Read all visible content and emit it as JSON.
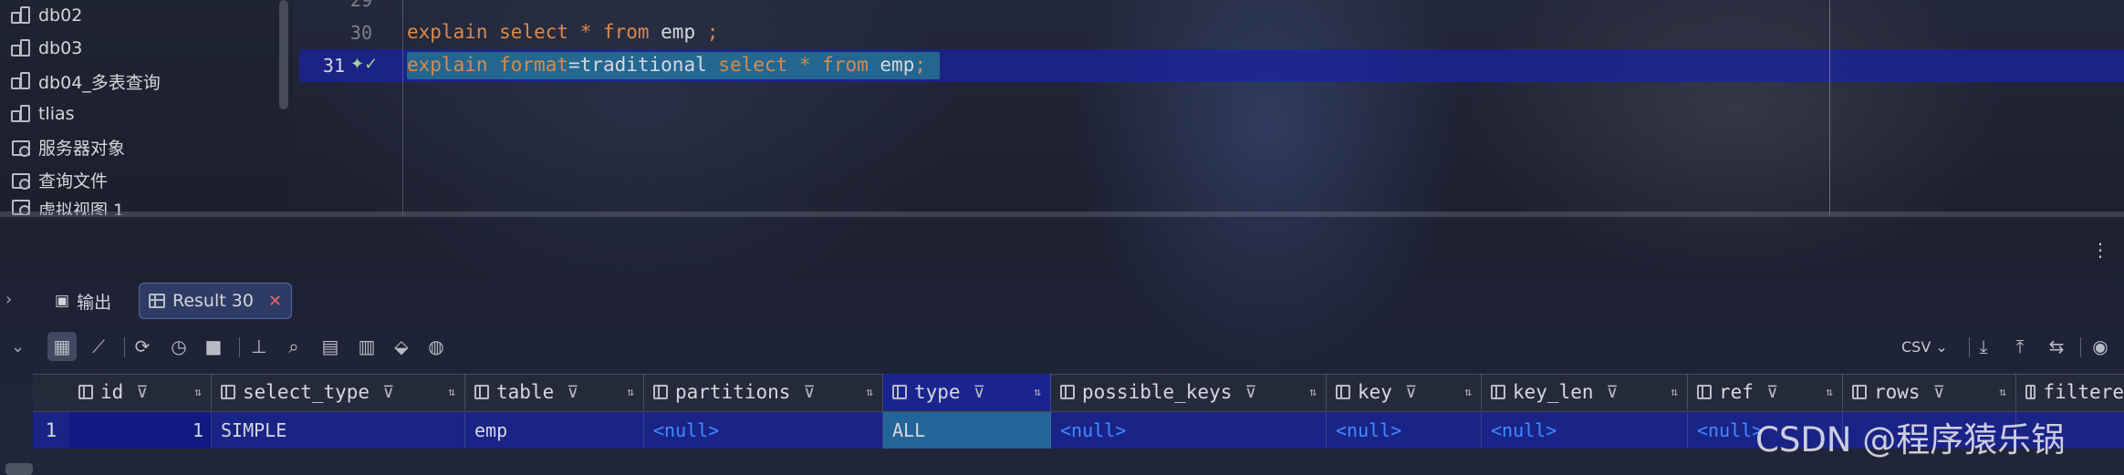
{
  "db_tree": {
    "items": [
      {
        "label": "db02",
        "icon": "schema-icon"
      },
      {
        "label": "db03",
        "icon": "schema-icon"
      },
      {
        "label": "db04_多表查询",
        "icon": "schema-icon"
      },
      {
        "label": "tlias",
        "icon": "schema-icon"
      },
      {
        "label": "服务器对象",
        "icon": "folder-icon"
      },
      {
        "label": "查询文件",
        "icon": "folder-icon"
      },
      {
        "label": "虚拟视图 1",
        "icon": "folder-icon"
      }
    ]
  },
  "editor": {
    "lines": [
      {
        "number": "29",
        "tokens": []
      },
      {
        "number": "30",
        "tokens": [
          {
            "text": "explain select * from ",
            "kind": "kw"
          },
          {
            "text": "emp",
            "kind": "plain"
          },
          {
            "text": " ;",
            "kind": "kw"
          }
        ]
      },
      {
        "number": "31",
        "tokens": [
          {
            "text": "explain format",
            "kind": "kw"
          },
          {
            "text": "=traditional ",
            "kind": "plain"
          },
          {
            "text": "select * from ",
            "kind": "kw"
          },
          {
            "text": "emp",
            "kind": "plain"
          },
          {
            "text": ";",
            "kind": "kw"
          }
        ]
      }
    ],
    "current_line": "31"
  },
  "results_panel": {
    "tabs": [
      {
        "label": "输出",
        "icon": "output-icon"
      },
      {
        "label": "Result 30",
        "icon": "table-icon",
        "closable": true
      }
    ],
    "active_tab": "Result 30",
    "toolbar": {
      "export_format": "CSV",
      "buttons": [
        "table-view-icon",
        "chart-icon",
        "refresh-icon",
        "history-icon",
        "stop-icon",
        "pin-icon",
        "search-icon",
        "edit-icon",
        "preview-icon",
        "bucket-icon",
        "globe-icon",
        "download-icon",
        "upload-icon",
        "compare-icon",
        "eye-icon"
      ]
    },
    "columns": [
      "id",
      "select_type",
      "table",
      "partitions",
      "type",
      "possible_keys",
      "key",
      "key_len",
      "ref",
      "rows",
      "filtere"
    ],
    "rows": [
      {
        "row_number": "1",
        "cells": [
          "1",
          "SIMPLE",
          "emp",
          "<null>",
          "ALL",
          "<null>",
          "<null>",
          "<null>",
          "<null>",
          "",
          ""
        ]
      }
    ],
    "selected_column": "type"
  },
  "watermark": "CSDN @程序猿乐锅",
  "colors": {
    "keyword": "#d98a4b",
    "null_value": "#3f8bff",
    "selection_blue": "#1a23a0",
    "close_red": "#e86a6a"
  }
}
